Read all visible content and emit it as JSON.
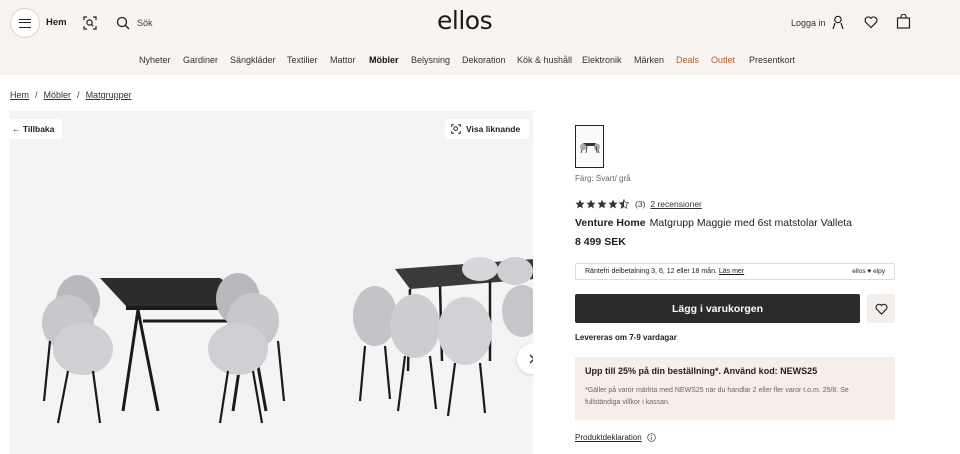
{
  "header": {
    "home_label": "Hem",
    "search_placeholder": "Sök",
    "logo_text": "ellos",
    "login_label": "Logga in"
  },
  "nav": {
    "items": [
      {
        "label": "Nyheter",
        "style": "normal"
      },
      {
        "label": "Gardiner",
        "style": "normal"
      },
      {
        "label": "Sängkläder",
        "style": "normal"
      },
      {
        "label": "Textilier",
        "style": "normal"
      },
      {
        "label": "Mattor",
        "style": "normal"
      },
      {
        "label": "Möbler",
        "style": "bold"
      },
      {
        "label": "Belysning",
        "style": "normal"
      },
      {
        "label": "Dekoration",
        "style": "normal"
      },
      {
        "label": "Kök & hushåll",
        "style": "normal"
      },
      {
        "label": "Elektronik",
        "style": "normal"
      },
      {
        "label": "Märken",
        "style": "normal"
      },
      {
        "label": "Deals",
        "style": "red"
      },
      {
        "label": "Outlet",
        "style": "red"
      },
      {
        "label": "Presentkort",
        "style": "normal"
      }
    ]
  },
  "breadcrumb": [
    "Hem",
    "Möbler",
    "Matgrupper"
  ],
  "gallery": {
    "back_label": "Tillbaka",
    "similar_label": "Visa liknande"
  },
  "product": {
    "color_label": "Färg: Svart/ grå",
    "rating": 4.5,
    "rating_count": "(3)",
    "reviews_link": "2 recensioner",
    "brand": "Venture Home",
    "name": "Matgrupp Maggie med 6st matstolar Valleta",
    "price": "8 499 SEK",
    "finance_text": "Räntefri delbetalning 3, 6, 12 eller 18 mån.",
    "finance_link": "Läs mer",
    "finance_logos": "ellos ♥ elpy",
    "cart_button": "Lägg i varukorgen",
    "delivery": "Levereras om 7-9 vardagar",
    "promo_title": "Upp till 25% på din beställning*. Använd kod: NEWS25",
    "promo_text": "*Gäller på varor märkta med NEWS25 när du handlar 2 eller fler varor t.o.m. 25/8. Se fullständiga villkor i kassan.",
    "declaration_link": "Produktdeklaration"
  },
  "colors": {
    "header_bg": "#f8f4f1",
    "accent_red": "#b55a2a",
    "cart_button": "#2b2b2b",
    "promo_bg": "#f7efe7"
  }
}
